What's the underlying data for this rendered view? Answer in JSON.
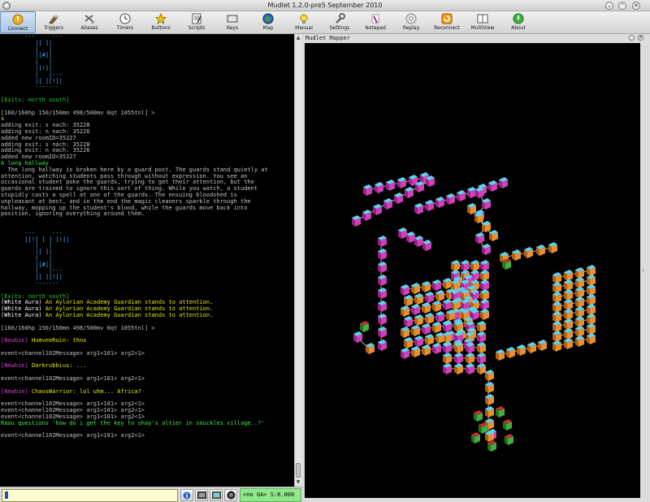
{
  "window": {
    "title": "Mudlet 1.2.0-pre5 September 2010"
  },
  "toolbar": [
    {
      "label": "Connect",
      "icon": "connect-icon"
    },
    {
      "label": "Triggers",
      "icon": "triggers-icon"
    },
    {
      "label": "Aliases",
      "icon": "aliases-icon"
    },
    {
      "label": "Timers",
      "icon": "timers-icon"
    },
    {
      "label": "Buttons",
      "icon": "buttons-icon"
    },
    {
      "label": "Scripts",
      "icon": "scripts-icon"
    },
    {
      "label": "Keys",
      "icon": "keys-icon"
    },
    {
      "label": "Map",
      "icon": "map-icon"
    },
    {
      "label": "Manual",
      "icon": "manual-icon"
    },
    {
      "label": "Settings",
      "icon": "settings-icon"
    },
    {
      "label": "Notepad",
      "icon": "notepad-icon"
    },
    {
      "label": "Replay",
      "icon": "replay-icon"
    },
    {
      "label": "Reconnect",
      "icon": "reconnect-icon"
    },
    {
      "label": "MultiView",
      "icon": "multiview-icon"
    },
    {
      "label": "About",
      "icon": "about-icon"
    }
  ],
  "console": {
    "lines": [
      {
        "c": "c-map",
        "t": "       ---     ---"
      },
      {
        "c": "c-map",
        "t": "          |[ ]|"
      },
      {
        "c": "c-map",
        "t": "          |   |"
      },
      {
        "c": "c-map",
        "t": "          |[#]|"
      },
      {
        "c": "c-map",
        "t": "          |   |"
      },
      {
        "c": "c-map",
        "t": "          |[!]|"
      },
      {
        "c": "c-map",
        "t": "          |   |---"
      },
      {
        "c": "c-map",
        "t": "          |[ ][!]|"
      },
      {
        "c": "c-map",
        "t": "          -------"
      },
      {
        "c": "c-gray",
        "t": ""
      },
      {
        "c": "c-green",
        "t": "[Exits: north south]"
      },
      {
        "c": "c-gray",
        "t": ""
      },
      {
        "c": "c-gray",
        "t": "[160/160hp 150/150mn 498/500mv 0qt 1055tnl] >"
      },
      {
        "c": "c-yellow",
        "t": "s"
      },
      {
        "c": "c-gray",
        "t": "adding exit: s nach: 35228"
      },
      {
        "c": "c-gray",
        "t": "adding exit: n nach: 35226"
      },
      {
        "c": "c-gray",
        "t": "added new roomID=35227"
      },
      {
        "c": "c-gray",
        "t": "adding exit: s nach: 35228"
      },
      {
        "c": "c-gray",
        "t": "adding exit: n nach: 35226"
      },
      {
        "c": "c-gray",
        "t": "added new roomID=35227"
      },
      {
        "c": "c-lgreen",
        "t": "A long hallway"
      },
      {
        "c": "c-gray",
        "t": "  The long hallway is broken here by a guard post. The guards stand quietly at"
      },
      {
        "c": "c-gray",
        "t": "attention, watching students pass through without expression. You see an"
      },
      {
        "c": "c-gray",
        "t": "occasional student poke the guards, trying to get their attention, but the"
      },
      {
        "c": "c-gray",
        "t": "guards are trained to ignore this sort of thing. While you watch, a student"
      },
      {
        "c": "c-gray",
        "t": "stupidly casts a spell at one of the guards. The ensuing bloodshed is"
      },
      {
        "c": "c-gray",
        "t": "unpleasant at best, and in the end the magic cleaners sparkle through the"
      },
      {
        "c": "c-gray",
        "t": "hallway, mopping up the student's blood, while the guards move back into"
      },
      {
        "c": "c-gray",
        "t": "position, ignoring everything around them."
      },
      {
        "c": "c-gray",
        "t": ""
      },
      {
        "c": "c-gray",
        "t": ""
      },
      {
        "c": "c-map",
        "t": "       ---     ---"
      },
      {
        "c": "c-map",
        "t": "       |[!] [ ] [!]|"
      },
      {
        "c": "c-map",
        "t": "          |   |"
      },
      {
        "c": "c-map",
        "t": "          |[ ]|"
      },
      {
        "c": "c-map",
        "t": "          |   |"
      },
      {
        "c": "c-map",
        "t": "          |[#]|"
      },
      {
        "c": "c-map",
        "t": "          |   |---"
      },
      {
        "c": "c-map",
        "t": "          |[ ][!]|"
      },
      {
        "c": "c-map",
        "t": "          -------"
      },
      {
        "c": "c-gray",
        "t": ""
      },
      {
        "c": "c-green",
        "t": "[Exits: north south]"
      },
      {
        "c": "c-white",
        "t": "(White Aura) ",
        "c2": "c-yellow",
        "t2": "An Aylorian Academy Guardian stands to attention."
      },
      {
        "c": "c-white",
        "t": "(White Aura) ",
        "c2": "c-yellow",
        "t2": "An Aylorian Academy Guardian stands to attention."
      },
      {
        "c": "c-white",
        "t": "(White Aura) ",
        "c2": "c-yellow",
        "t2": "An Aylorian Academy Guardian stands to attention."
      },
      {
        "c": "c-gray",
        "t": ""
      },
      {
        "c": "c-gray",
        "t": "[160/160hp 150/150mn 498/500mv 0qt 1055tnl] >"
      },
      {
        "c": "c-gray",
        "t": ""
      },
      {
        "c": "c-mag",
        "t": "[Newbie] ",
        "c2": "c-yellow",
        "t2": "HumveeRuin: thnx"
      },
      {
        "c": "c-gray",
        "t": ""
      },
      {
        "c": "c-gray",
        "t": "event<channel102Message> arg1<101> arg2<1>"
      },
      {
        "c": "c-gray",
        "t": ""
      },
      {
        "c": "c-mag",
        "t": "[Newbie] ",
        "c2": "c-yellow",
        "t2": "Darkrubbius: ..."
      },
      {
        "c": "c-gray",
        "t": ""
      },
      {
        "c": "c-gray",
        "t": "event<channel102Message> arg1<101> arg2<1>"
      },
      {
        "c": "c-gray",
        "t": ""
      },
      {
        "c": "c-mag",
        "t": "[Newbie] ",
        "c2": "c-yellow",
        "t2": "ChaosWarrior: lol uhm... Africa?"
      },
      {
        "c": "c-gray",
        "t": ""
      },
      {
        "c": "c-gray",
        "t": "event<channel102Message> arg1<101> arg2<1>"
      },
      {
        "c": "c-gray",
        "t": "event<channel102Message> arg1<101> arg2<1>"
      },
      {
        "c": "c-gray",
        "t": "event<channel102Message> arg1<101> arg2<1>"
      },
      {
        "c": "c-lgreen",
        "t": "Raou questions 'how do i get the key to shay's altier in snuckles village..?'"
      },
      {
        "c": "c-gray",
        "t": ""
      },
      {
        "c": "c-gray",
        "t": "event<channel102Message> arg1<101> arg2<1>"
      }
    ]
  },
  "mapper": {
    "title": "Mudlet Mapper"
  },
  "command_line": {
    "value": ""
  },
  "lag_meter": {
    "text": "<no GA> S:0.000"
  }
}
